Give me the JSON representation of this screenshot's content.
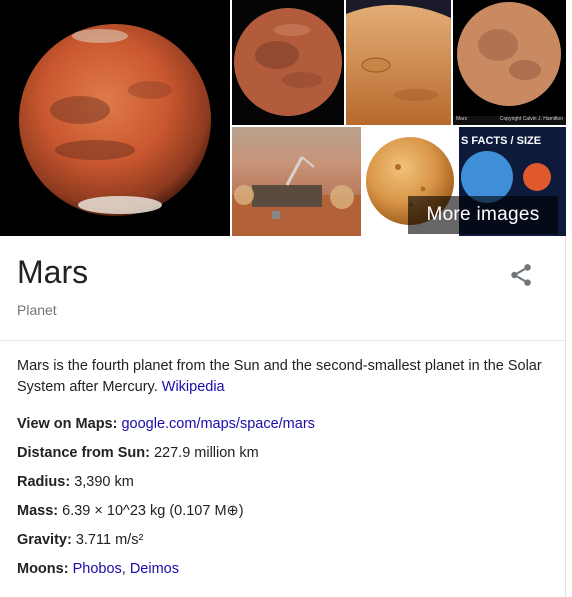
{
  "gallery": {
    "more_images_label": "More images",
    "size_banner": "S FACTS / SIZE",
    "credit_left": "Mars",
    "credit_right": "Copyright Calvin J. Hamilton"
  },
  "knowledge_panel": {
    "title": "Mars",
    "subtitle": "Planet",
    "share_icon": "share-icon",
    "description": "Mars is the fourth planet from the Sun and the second-smallest planet in the Solar System after Mercury.",
    "description_link": "Wikipedia",
    "facts": [
      {
        "label": "View on Maps:",
        "value": "google.com/maps/space/mars",
        "is_link": true
      },
      {
        "label": "Distance from Sun:",
        "value": "227.9 million km"
      },
      {
        "label": "Radius:",
        "value": "3,390 km"
      },
      {
        "label": "Mass:",
        "value": "6.39 × 10^23 kg (0.107 M⊕)"
      },
      {
        "label": "Gravity:",
        "value": "3.711 m/s²"
      },
      {
        "label": "Moons:",
        "links": [
          "Phobos",
          "Deimos"
        ],
        "separator": ", "
      }
    ]
  },
  "colors": {
    "link": "#1a0dab",
    "muted": "#70757a",
    "text": "#222222"
  }
}
